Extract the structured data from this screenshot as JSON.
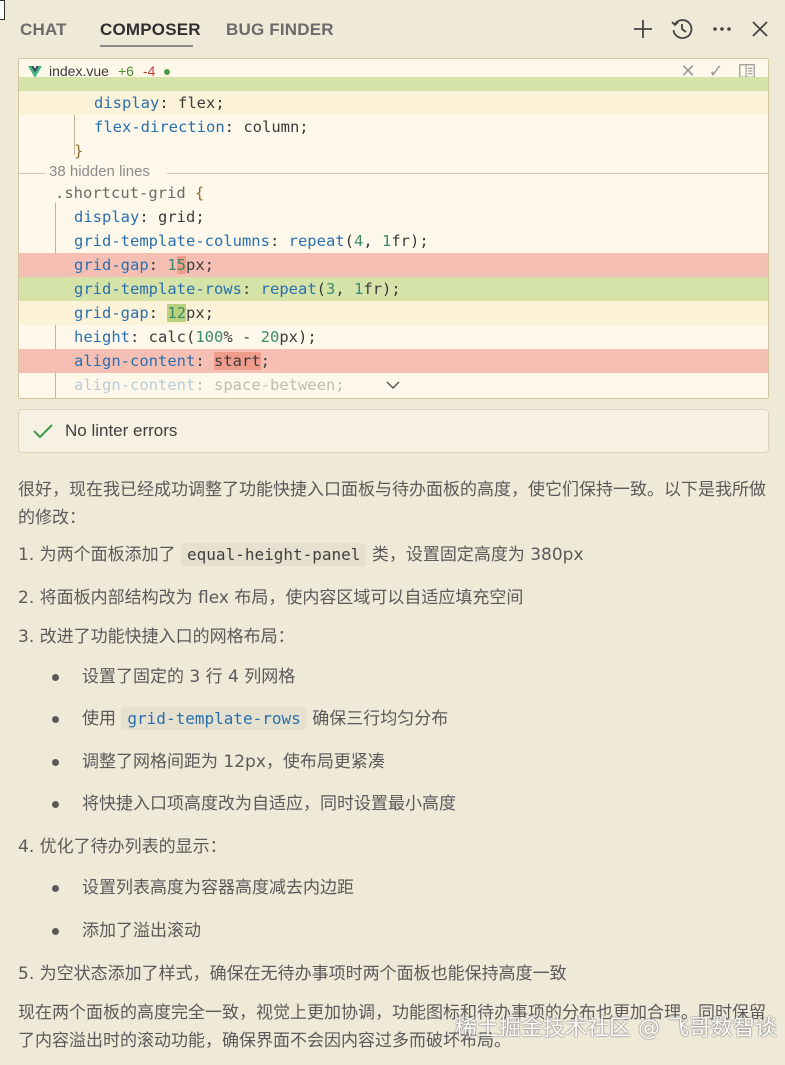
{
  "tabs": [
    {
      "label": "CHAT"
    },
    {
      "label": "COMPOSER"
    },
    {
      "label": "BUG FINDER"
    }
  ],
  "toolbar": {
    "icons": [
      "plus-icon",
      "history-icon",
      "more-icon",
      "close-icon"
    ]
  },
  "diff": {
    "file_name": "index.vue",
    "added": "+6",
    "removed": "-4",
    "hidden_lines": "38 hidden lines",
    "header_icons": [
      "close-icon",
      "check-icon",
      "split-view-icon"
    ]
  },
  "linter": {
    "text": "No linter errors"
  },
  "message": {
    "intro": "很好，现在我已经成功调整了功能快捷入口面板与待办面板的高度，使它们保持一致。以下是我所做的修改：",
    "item1_prefix": "1. 为两个面板添加了",
    "item1_code": "equal-height-panel",
    "item1_suffix": "类，设置固定高度为 380px",
    "item2": "2. 将面板内部结构改为 flex 布局，使内容区域可以自适应填充空间",
    "item3": "3. 改进了功能快捷入口的网格布局：",
    "item3_sub1": "设置了固定的 3 行 4 列网格",
    "item3_sub2_prefix": "使用",
    "item3_sub2_code": "grid-template-rows",
    "item3_sub2_suffix": "确保三行均匀分布",
    "item3_sub3": "调整了网格间距为 12px，使布局更紧凑",
    "item3_sub4": "将快捷入口项高度改为自适应，同时设置最小高度",
    "item4": "4. 优化了待办列表的显示：",
    "item4_sub1": "设置列表高度为容器高度减去内边距",
    "item4_sub2": "添加了溢出滚动",
    "item5": "5. 为空状态添加了样式，确保在无待办事项时两个面板也能保持高度一致",
    "outro": "现在两个面板的高度完全一致，视觉上更加协调，功能图标和待办事项的分布也更加合理。同时保留了内容溢出时的滚动功能，确保界面不会因内容过多而破坏布局。"
  },
  "watermark": "稀土掘金技术社区 @ 飞哥数智谈"
}
